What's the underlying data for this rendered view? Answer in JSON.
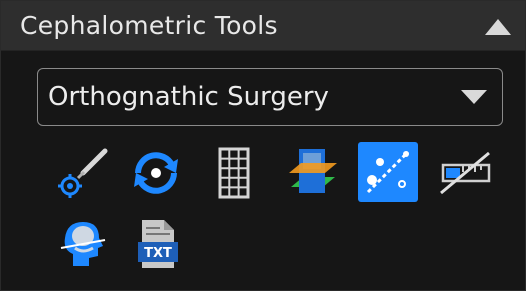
{
  "panel": {
    "title": "Cephalometric Tools",
    "collapse_icon": "triangle-up-icon"
  },
  "dropdown": {
    "selected": "Orthognathic Surgery",
    "arrow_icon": "triangle-down-icon"
  },
  "tools": [
    {
      "icon": "landmark-pen-icon",
      "active": false
    },
    {
      "icon": "rotate-view-icon",
      "active": false
    },
    {
      "icon": "grid-icon",
      "active": false
    },
    {
      "icon": "layered-planes-icon",
      "active": false
    },
    {
      "icon": "measure-line-icon",
      "active": true
    },
    {
      "icon": "ruler-disabled-icon",
      "active": false
    },
    {
      "icon": "head-profile-icon",
      "active": false
    },
    {
      "icon": "txt-export-icon",
      "active": false
    }
  ],
  "colors": {
    "accent": "#1e88ff",
    "background": "#161616",
    "header": "#2e2e2e"
  }
}
